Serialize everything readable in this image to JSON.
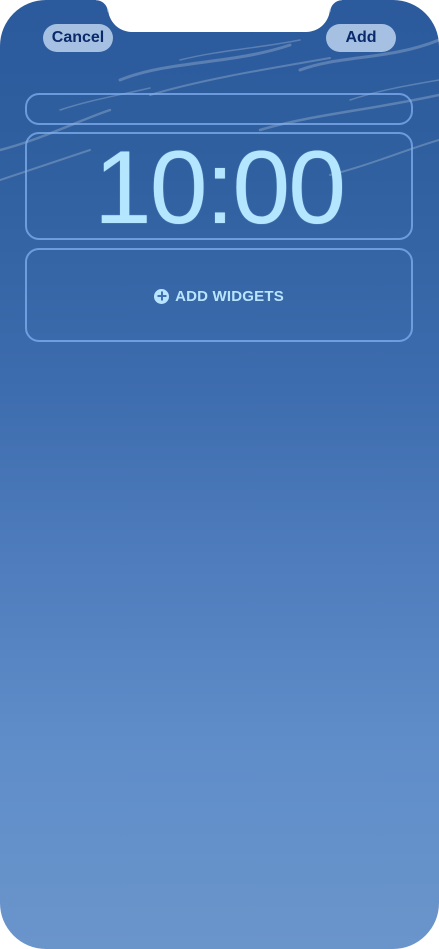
{
  "header": {
    "cancel_label": "Cancel",
    "add_label": "Add"
  },
  "lock_screen": {
    "time": "10:00",
    "add_widgets_label": "ADD WIDGETS",
    "add_widgets_icon": "plus-circle-icon"
  },
  "colors": {
    "wallpaper_top": "#2b5a9d",
    "wallpaper_bottom": "#6a95cb",
    "clock_text": "#b4e6ff",
    "button_text": "#0b2a6b",
    "slot_outline": "#82afef"
  }
}
